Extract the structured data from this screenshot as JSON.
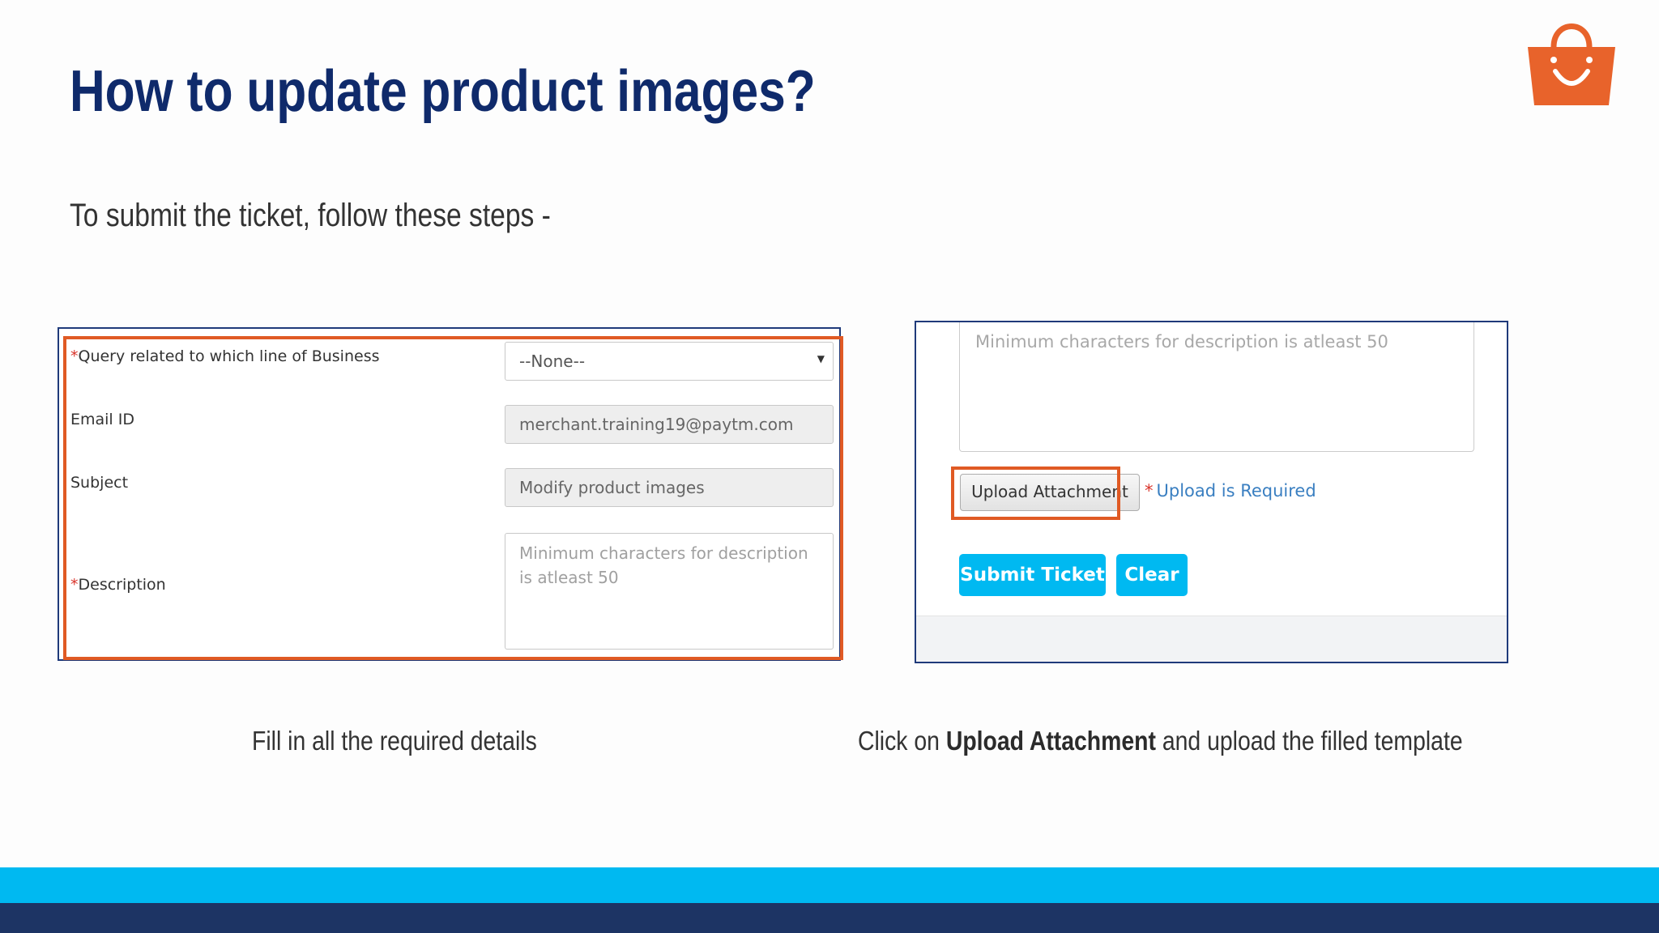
{
  "slide": {
    "title": "How to update product images?",
    "subtitle": "To submit the ticket, follow these steps -"
  },
  "logo": {
    "icon": "shopping-bag-icon",
    "color": "#e8632b"
  },
  "form_left": {
    "query_label": "Query related to which line of Business",
    "query_value": "--None--",
    "email_label": "Email ID",
    "email_value": "merchant.training19@paytm.com",
    "subject_label": "Subject",
    "subject_value": "Modify product images",
    "description_label": "Description",
    "description_placeholder": "Minimum characters for description is atleast 50",
    "required_mark": "*"
  },
  "form_right": {
    "description_placeholder": "Minimum characters for description is atleast 50",
    "upload_button": "Upload Attachment",
    "upload_required_mark": "*",
    "upload_required": "Upload is Required",
    "submit_button": "Submit Ticket",
    "clear_button": "Clear"
  },
  "captions": {
    "left": "Fill in all the required details",
    "right_prefix": "Click on ",
    "right_bold": "Upload Attachment",
    "right_suffix": " and upload the filled template"
  },
  "colors": {
    "title": "#0f2a6b",
    "highlight": "#e05a24",
    "accent": "#00b9f1",
    "footer_dark": "#1d3464"
  }
}
